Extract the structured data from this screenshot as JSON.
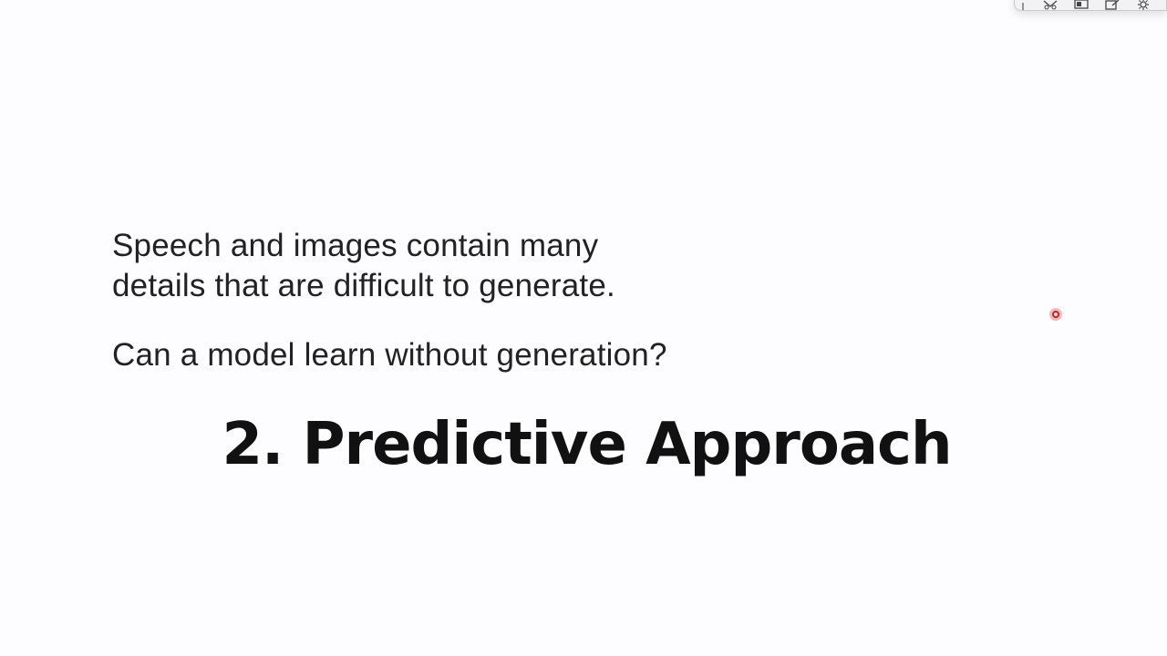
{
  "slide": {
    "line1": "Speech and images contain many",
    "line2": "details that are difficult to generate.",
    "question": "Can a model learn without generation?",
    "title": "2. Predictive Approach"
  },
  "toolbar": {
    "icons": [
      "scissors-icon",
      "screen-icon",
      "edit-icon",
      "settings-icon"
    ]
  },
  "colors": {
    "background": "#fdfdff",
    "text": "#222222",
    "pointer": "#e01818"
  }
}
